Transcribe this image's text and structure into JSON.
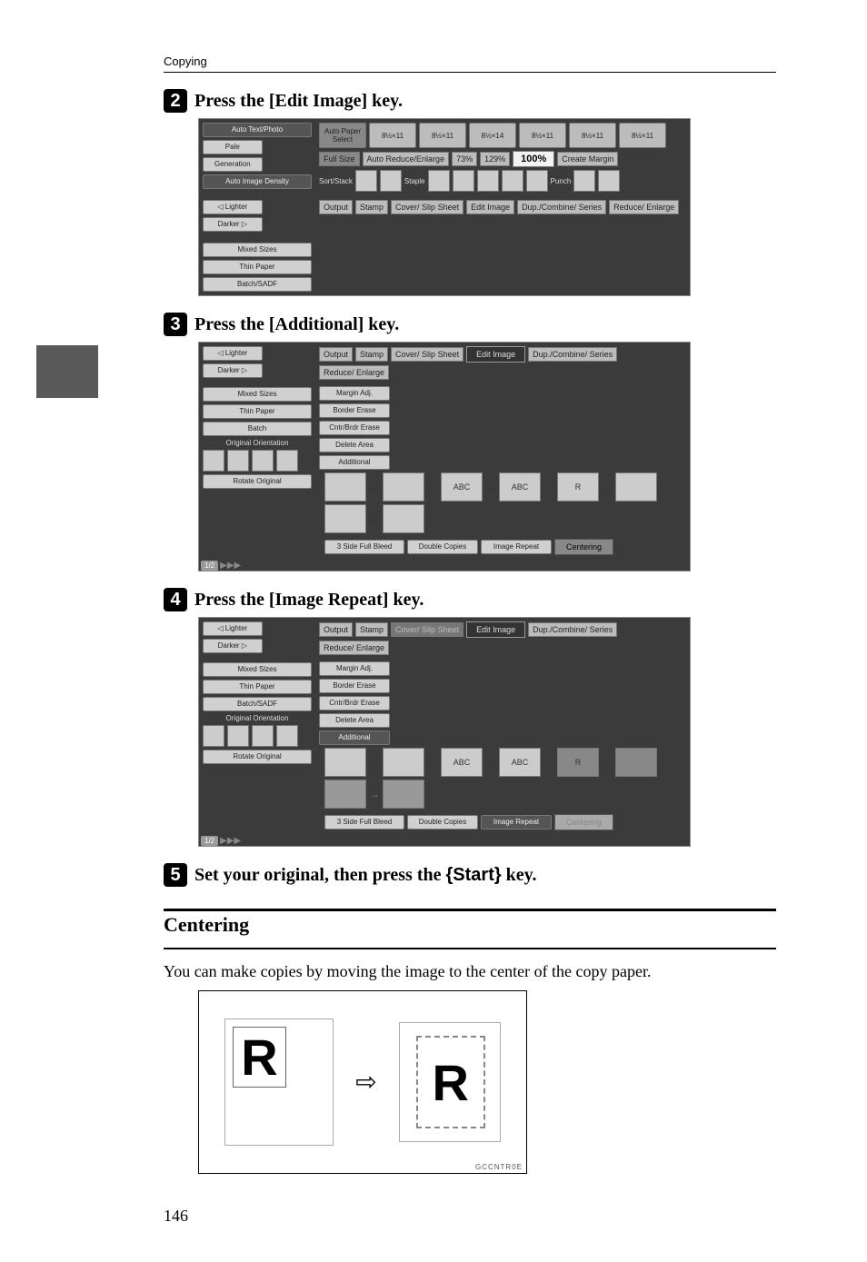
{
  "header_category": "Copying",
  "steps": {
    "s2": "Press the [Edit Image] key.",
    "s3": "Press the [Additional] key.",
    "s4": "Press the [Image Repeat] key.",
    "s5_pre": "Set your original, then press the ",
    "s5_key": "{Start}",
    "s5_post": " key."
  },
  "centering": {
    "title": "Centering",
    "body": "You can make copies by moving the image to the center of the copy paper.",
    "diagram_letter": "R",
    "diagram_code": "GCCNTR0E"
  },
  "screenshot_common": {
    "left": {
      "auto_text_photo": "Auto Text/Photo",
      "pale": "Pale",
      "generation": "Generation",
      "auto_image_density": "Auto Image Density",
      "lighter": "Lighter",
      "darker": "Darker",
      "mixed_sizes": "Mixed Sizes",
      "thin_paper": "Thin Paper",
      "batch_sadf": "Batch/SADF",
      "batch": "Batch",
      "orig_orientation": "Original Orientation",
      "rotate_original": "Rotate Original"
    },
    "right": {
      "auto_paper_select": "Auto\nPaper Select",
      "paper_sizes": [
        "8½×11",
        "8½×11",
        "8½×14",
        "8½×11",
        "8½×11",
        "8½×11"
      ],
      "full_size": "Full Size",
      "auto_reduce_enlarge": "Auto Reduce/Enlarge",
      "pct_73": "73%",
      "pct_129": "129%",
      "pct_100": "100%",
      "create_margin": "Create Margin",
      "sort_stack": "Sort/Stack",
      "staple": "Staple",
      "punch": "Punch",
      "tabs": {
        "output": "Output",
        "stamp": "Stamp",
        "cover_slip": "Cover/\nSlip Sheet",
        "edit_image": "Edit\nImage",
        "dup_combine": "Dup./Combine/\nSeries",
        "reduce_enlarge": "Reduce/\nEnlarge"
      },
      "edit_buttons": {
        "margin_adj": "Margin Adj.",
        "border_erase": "Border Erase",
        "cntr_brdr_erase": "Cntr/Brdr Erase",
        "delete_area": "Delete Area",
        "additional": "Additional",
        "three_side_full_bleed": "3 Side Full Bleed",
        "double_copies": "Double Copies",
        "image_repeat": "Image Repeat",
        "centering": "Centering"
      },
      "op_abc": "ABC",
      "page_indicator": "1/2"
    }
  },
  "page_number": "146"
}
